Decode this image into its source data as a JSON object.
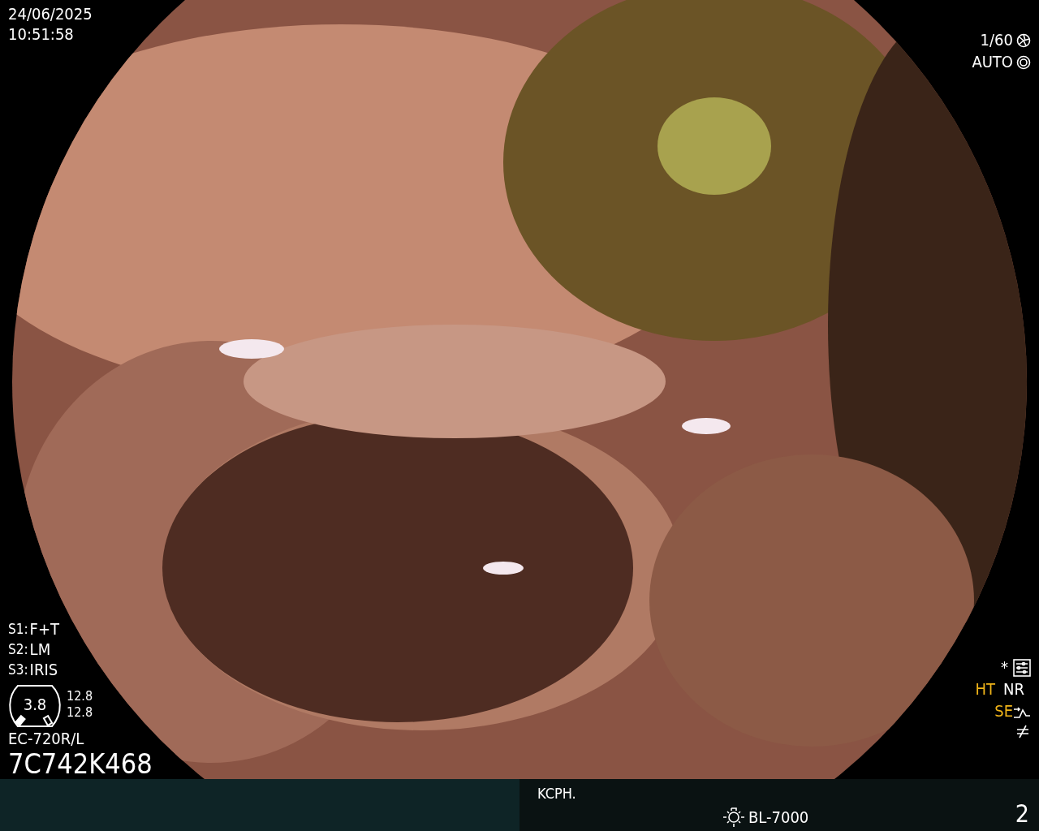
{
  "datetime": {
    "date": "24/06/2025",
    "time": "10:51:58"
  },
  "exposure": {
    "shutter": "1/60",
    "iris_mode": "AUTO"
  },
  "switches": [
    {
      "label": "S1:",
      "value": "F+T"
    },
    {
      "label": "S2:",
      "value": "LM"
    },
    {
      "label": "S3:",
      "value": "IRIS"
    }
  ],
  "scope_gauge": {
    "value": "3.8",
    "readings": [
      "12.8",
      "12.8"
    ]
  },
  "scope_model": "EC-720R/L",
  "serial": "7C742K468",
  "enhancements": {
    "marker": "*",
    "modes": [
      {
        "label": "HT",
        "on": true
      },
      {
        "label": "NR",
        "on": false
      }
    ],
    "structure": {
      "label": "SE",
      "on": true
    }
  },
  "footer": {
    "label": "KCPH.",
    "light_source": "BL-7000",
    "page": "2"
  }
}
